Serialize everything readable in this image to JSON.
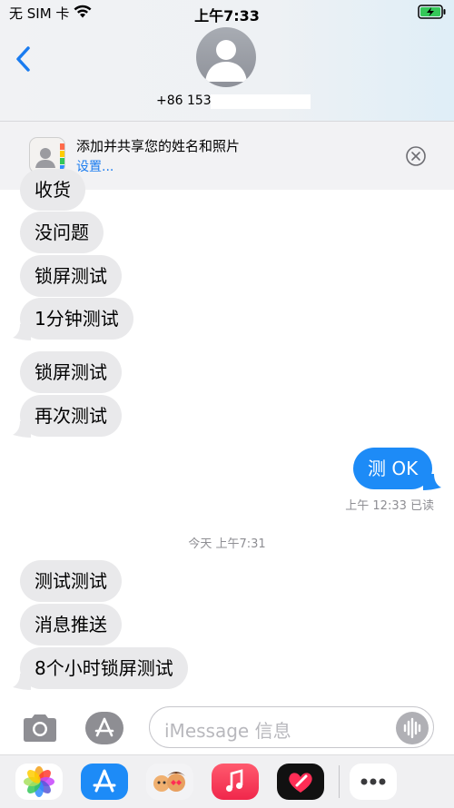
{
  "status_bar": {
    "carrier": "无 SIM 卡",
    "time": "上午7:33"
  },
  "header": {
    "phone": "+86 153"
  },
  "banner": {
    "title": "添加并共享您的姓名和照片",
    "link": "设置..."
  },
  "messages_block1": [
    {
      "text": "收货"
    },
    {
      "text": "没问题"
    },
    {
      "text": "锁屏测试"
    },
    {
      "text": "1分钟测试"
    }
  ],
  "messages_block2": [
    {
      "text": "锁屏测试"
    },
    {
      "text": "再次测试"
    }
  ],
  "outgoing": {
    "text": "测 OK",
    "receipt": "上午 12:33 已读"
  },
  "divider_timestamp": "今天 上午7:31",
  "messages_block3": [
    {
      "text": "测试测试"
    },
    {
      "text": "消息推送"
    },
    {
      "text": "8个小时锁屏测试"
    }
  ],
  "input": {
    "placeholder": "iMessage 信息"
  },
  "colors": {
    "incoming": "#e9e9eb",
    "outgoing": "#1d8bf7",
    "link": "#1a7cf0"
  },
  "app_drawer": [
    "photos-app-icon",
    "app-store-app-icon",
    "memoji-app-icon",
    "music-app-icon",
    "digital-touch-app-icon",
    "more-apps-icon"
  ]
}
